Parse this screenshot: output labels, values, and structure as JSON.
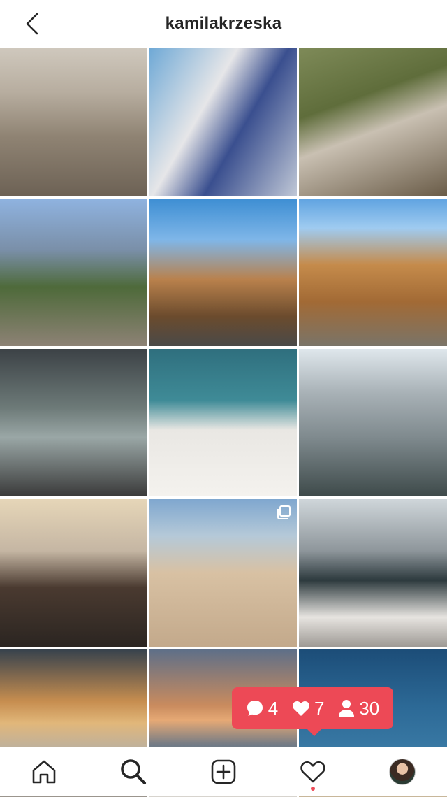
{
  "header": {
    "title": "kamilakrzeska"
  },
  "grid": {
    "tiles": [
      {
        "id": 1,
        "kind": "photo"
      },
      {
        "id": 2,
        "kind": "photo"
      },
      {
        "id": 3,
        "kind": "photo"
      },
      {
        "id": 4,
        "kind": "photo"
      },
      {
        "id": 5,
        "kind": "photo"
      },
      {
        "id": 6,
        "kind": "photo"
      },
      {
        "id": 7,
        "kind": "photo"
      },
      {
        "id": 8,
        "kind": "photo"
      },
      {
        "id": 9,
        "kind": "photo"
      },
      {
        "id": 10,
        "kind": "photo"
      },
      {
        "id": 11,
        "kind": "carousel"
      },
      {
        "id": 12,
        "kind": "photo"
      },
      {
        "id": 13,
        "kind": "photo"
      },
      {
        "id": 14,
        "kind": "photo"
      },
      {
        "id": 15,
        "kind": "photo"
      }
    ]
  },
  "activity": {
    "comments": "4",
    "likes": "7",
    "follows": "30"
  },
  "nav": {
    "items": [
      "home-icon",
      "search-icon",
      "new-post-icon",
      "activity-heart-icon",
      "profile-avatar"
    ]
  },
  "colors": {
    "accent": "#ed4956",
    "text": "#262626",
    "border": "#dbdbdb"
  }
}
